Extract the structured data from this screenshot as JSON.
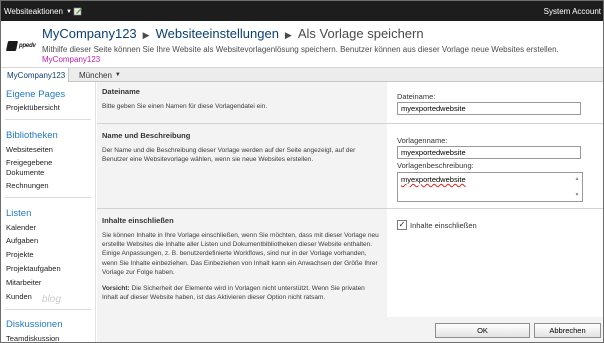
{
  "topbar": {
    "site_actions_label": "Websiteaktionen",
    "account_label": "System Account"
  },
  "header": {
    "logo_text": "ppedv",
    "breadcrumb": {
      "site": "MyCompany123",
      "settings": "Websiteeinstellungen",
      "current": "Als Vorlage speichern"
    },
    "description": "Mithilfe dieser Seite können Sie Ihre Website als Websitevorlagenlösung speichern. Benutzer können aus dieser Vorlage neue Websites erstellen.",
    "site_link": "MyCompany123"
  },
  "tabs": {
    "home": "MyCompany123",
    "munich": "München"
  },
  "leftnav": {
    "heading_pages": "Eigene Pages",
    "item_project_overview": "Projektübersicht",
    "heading_libraries": "Bibliotheken",
    "item_site_pages": "Websiteseiten",
    "item_shared_docs": "Freigegebene Dokumente",
    "item_invoices": "Rechnungen",
    "heading_lists": "Listen",
    "item_calendar": "Kalender",
    "item_tasks": "Aufgaben",
    "item_projects": "Projekte",
    "item_project_tasks": "Projektaufgaben",
    "item_employees": "Mitarbeiter",
    "item_customers": "Kunden",
    "watermark": "blog",
    "heading_discussions": "Diskussionen",
    "item_team_discussion": "Teamdiskussion"
  },
  "main": {
    "filename_section": {
      "title": "Dateiname",
      "text": "Bitte geben Sie einen Namen für diese Vorlagendatei ein.",
      "field_label": "Dateiname:",
      "field_value": "myexportedwebsite"
    },
    "name_section": {
      "title": "Name und Beschreibung",
      "text": "Der Name und die Beschreibung dieser Vorlage werden auf der Seite angezeigt, auf der Benutzer eine Websitevorlage wählen, wenn sie neue Websites erstellen.",
      "template_name_label": "Vorlagenname:",
      "template_name_value": "myexportedwebsite",
      "template_desc_label": "Vorlagenbeschreibung:",
      "template_desc_value": "myexportedwebsite"
    },
    "content_section": {
      "title": "Inhalte einschließen",
      "text": "Sie können Inhalte in Ihre Vorlage einschließen, wenn Sie möchten, dass mit dieser Vorlage neu erstellte Websites die Inhalte aller Listen und Dokumentbibliotheken dieser Website enthalten. Einige Anpassungen, z. B. benutzerdefinierte Workflows, sind nur in der Vorlage vorhanden, wenn Sie Inhalte einbeziehen. Das Einbeziehen von Inhalt kann ein Anwachsen der Größe Ihrer Vorlage zur Folge haben.",
      "caution_label": "Vorsicht:",
      "caution_text": "Die Sicherheit der Elemente wird in Vorlagen nicht unterstützt. Wenn Sie privaten Inhalt auf dieser Website haben, ist das Aktivieren dieser Option nicht ratsam.",
      "checkbox_label": "Inhalte einschließen",
      "checkbox_checked": true
    },
    "buttons": {
      "ok": "OK",
      "cancel": "Abbrechen"
    }
  },
  "colors": {
    "topbar_bg": "#1d1d1d",
    "breadcrumb": "#0b3f73",
    "nav_heading": "#2479c4",
    "site_link": "#c01fab"
  }
}
